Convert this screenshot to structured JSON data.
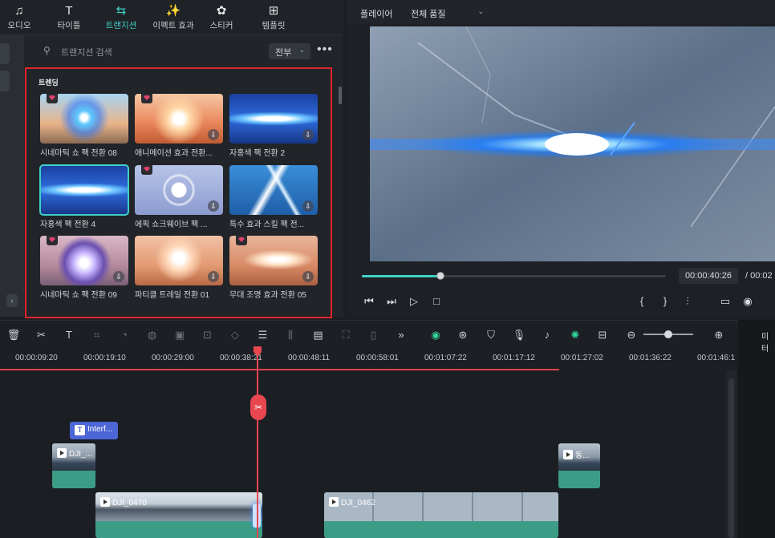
{
  "nav": {
    "items": [
      {
        "label": "오디오",
        "icon": "music-note-icon",
        "glyph": "♫"
      },
      {
        "label": "타이틀",
        "icon": "title-T-icon",
        "glyph": "T"
      },
      {
        "label": "트랜지션",
        "icon": "transition-arrows-icon",
        "glyph": "⇆"
      },
      {
        "label": "이펙트 효과",
        "icon": "effects-sparkle-icon",
        "glyph": "✨"
      },
      {
        "label": "스티커",
        "icon": "sticker-icon",
        "glyph": "✿"
      },
      {
        "label": "템플릿",
        "icon": "template-grid-icon",
        "glyph": "⊞"
      }
    ],
    "active_index": 2
  },
  "search": {
    "placeholder": "트랜지션 검색",
    "filter_value": "전부"
  },
  "section": {
    "title": "트렌딩"
  },
  "cards": [
    {
      "label": "시네마틱 쇼 팩 전환 08",
      "premium": true,
      "download": false,
      "selected": false,
      "style": "sunset-flare"
    },
    {
      "label": "애니메이션 효과 전환...",
      "premium": true,
      "download": true,
      "selected": false,
      "style": "orange-burst"
    },
    {
      "label": "자홍색 팩 전환 2",
      "premium": false,
      "download": true,
      "selected": false,
      "style": "blue-streak"
    },
    {
      "label": "자홍색 팩 전환 4",
      "premium": false,
      "download": false,
      "selected": true,
      "style": "blue-streak"
    },
    {
      "label": "에픽 쇼크웨이브 팩 ...",
      "premium": true,
      "download": true,
      "selected": false,
      "style": "ring"
    },
    {
      "label": "특수 효과 스킬 팩 전...",
      "premium": false,
      "download": true,
      "selected": false,
      "style": "lightning"
    },
    {
      "label": "시네마틱 쇼 팩 전환 09",
      "premium": true,
      "download": true,
      "selected": false,
      "style": "purple-star"
    },
    {
      "label": "파티클 트레일 전환 01",
      "premium": false,
      "download": true,
      "selected": false,
      "style": "desert-sun"
    },
    {
      "label": "무대 조명 효과 전환 05",
      "premium": true,
      "download": true,
      "selected": false,
      "style": "desert-glow"
    }
  ],
  "player": {
    "label": "플레이어",
    "quality": "전체 품질",
    "current_time": "00:00:40:26",
    "total_time": "/ 00:02",
    "progress": 0.26
  },
  "player_controls": [
    {
      "name": "prev-frame-icon",
      "glyph": "⏮"
    },
    {
      "name": "next-frame-icon",
      "glyph": "⏭"
    },
    {
      "name": "play-icon",
      "glyph": "▷"
    },
    {
      "name": "stop-icon",
      "glyph": "□"
    },
    {
      "name": "mark-in-icon",
      "glyph": "{"
    },
    {
      "name": "mark-out-icon",
      "glyph": "}"
    },
    {
      "name": "clip-marker-icon",
      "glyph": "⫶"
    },
    {
      "name": "display-icon",
      "glyph": "▭"
    },
    {
      "name": "snapshot-icon",
      "glyph": "◉"
    },
    {
      "name": "volume-icon",
      "glyph": "◁"
    }
  ],
  "toolbar": [
    {
      "name": "delete-icon",
      "glyph": "🗑",
      "dim": false
    },
    {
      "name": "split-scissors-icon",
      "glyph": "✂",
      "dim": false
    },
    {
      "name": "text-icon",
      "glyph": "T",
      "dim": false
    },
    {
      "name": "crop-icon",
      "glyph": "⌗",
      "dim": true
    },
    {
      "name": "speed-icon",
      "glyph": "◔",
      "dim": true
    },
    {
      "name": "color-icon",
      "glyph": "◍",
      "dim": true
    },
    {
      "name": "mask-icon",
      "glyph": "▣",
      "dim": true
    },
    {
      "name": "freeze-icon",
      "glyph": "⊡",
      "dim": true
    },
    {
      "name": "keyframe-icon",
      "glyph": "◇",
      "dim": true
    },
    {
      "name": "adjust-icon",
      "glyph": "☰",
      "dim": false
    },
    {
      "name": "audio-wave-icon",
      "glyph": "⫼",
      "dim": true
    },
    {
      "name": "speech-icon",
      "glyph": "▤",
      "dim": false
    },
    {
      "name": "motion-icon",
      "glyph": "⛶",
      "dim": true
    },
    {
      "name": "stretch-icon",
      "glyph": "▯",
      "dim": true
    },
    {
      "name": "more-icon",
      "glyph": "»",
      "dim": false
    }
  ],
  "toolbar_right": [
    {
      "name": "ai-assistant-icon",
      "glyph": "◉",
      "color": "#35d49a"
    },
    {
      "name": "render-icon",
      "glyph": "⊛",
      "color": "#cfd2d7"
    },
    {
      "name": "shield-icon",
      "glyph": "⛉",
      "color": "#cfd2d7"
    },
    {
      "name": "mic-icon",
      "glyph": "🎙",
      "color": "#cfd2d7"
    },
    {
      "name": "music-list-icon",
      "glyph": "♪",
      "color": "#cfd2d7"
    },
    {
      "name": "sparkle-icon",
      "glyph": "✺",
      "color": "#35d49a"
    },
    {
      "name": "fit-icon",
      "glyph": "⊟",
      "color": "#cfd2d7"
    },
    {
      "name": "zoom-out-icon",
      "glyph": "⊖",
      "color": "#cfd2d7"
    },
    {
      "name": "zoom-in-icon",
      "glyph": "⊕",
      "color": "#cfd2d7"
    }
  ],
  "zoom": 0.5,
  "meter_label": "미터",
  "ruler_ticks": [
    "00:00:09:20",
    "00:00:19:10",
    "00:00:29:00",
    "00:00:38:21",
    "00:00:48:11",
    "00:00:58:01",
    "00:01:07:22",
    "00:01:17:12",
    "00:01:27:02",
    "00:01:36:22",
    "00:01:46:1"
  ],
  "clips": {
    "text_clip": "Interf...",
    "video_small_1": "DJI_...",
    "video_small_2": "동...",
    "video_main_1": "DJI_0470",
    "video_main_2": "DJI_0462"
  },
  "colors": {
    "accent": "#3fd1c7",
    "playhead": "#e8474f",
    "highlight_box": "#e0252c",
    "clip": "#3c9c85",
    "text_clip": "#4d66d6"
  }
}
